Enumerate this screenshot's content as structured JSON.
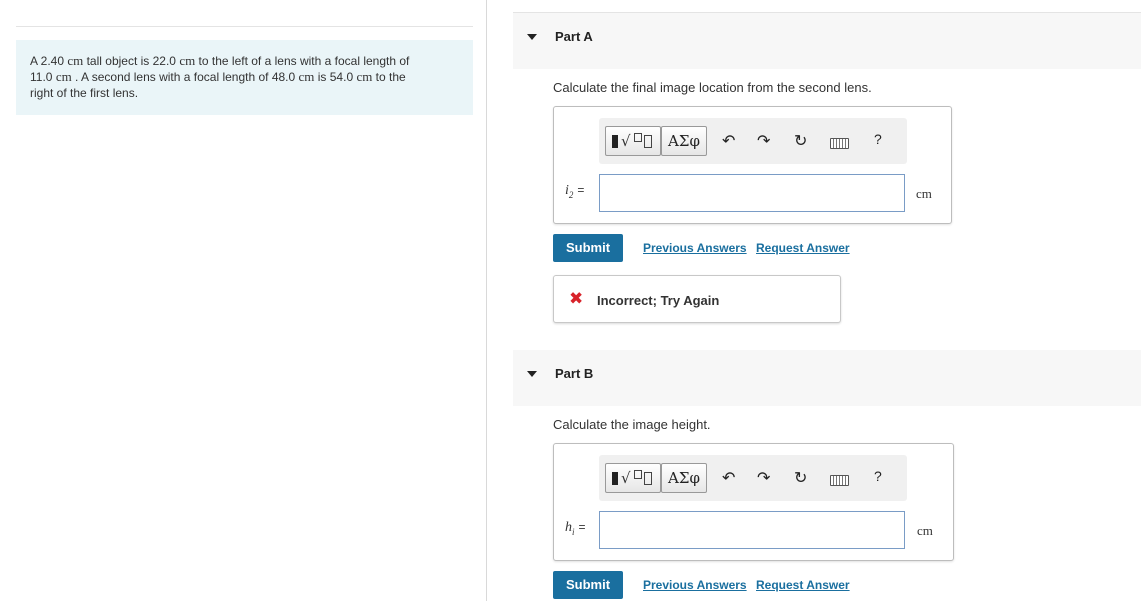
{
  "problem": {
    "seg1": "A 2.40 ",
    "u1": "cm",
    "seg2": " tall object is 22.0 ",
    "u2": "cm",
    "seg3": " to the left of a lens with a focal length of",
    "seg4": "11.0 ",
    "u3": "cm",
    "seg5": " . A second lens with a focal length of 48.0 ",
    "u4": "cm",
    "seg6": " is 54.0 ",
    "u5": "cm",
    "seg7": " to the",
    "seg8": "right of the first lens."
  },
  "toolbar": {
    "greek_label": "ΑΣφ",
    "help_label": "?",
    "icons": [
      "templates-icon",
      "greek-symbols-icon",
      "undo-icon",
      "redo-icon",
      "reset-icon",
      "keyboard-icon",
      "help-icon"
    ]
  },
  "partA": {
    "title": "Part A",
    "question": "Calculate the final image location from the second lens.",
    "var_symbol": "i",
    "var_sub": "2",
    "equals": "=",
    "input_value": "",
    "unit": "cm",
    "submit_label": "Submit",
    "previous_answers": "Previous Answers",
    "request_answer": "Request Answer",
    "feedback": "Incorrect; Try Again"
  },
  "partB": {
    "title": "Part B",
    "question": "Calculate the image height.",
    "var_symbol": "h",
    "var_sub": "i",
    "equals": "=",
    "input_value": "",
    "unit": "cm",
    "submit_label": "Submit",
    "previous_answers": "Previous Answers",
    "request_answer": "Request Answer"
  },
  "colors": {
    "problem_bg": "#eaf5f8",
    "submit_bg": "#1a6f9f",
    "link": "#1a6f9f",
    "error": "#d8232a"
  }
}
